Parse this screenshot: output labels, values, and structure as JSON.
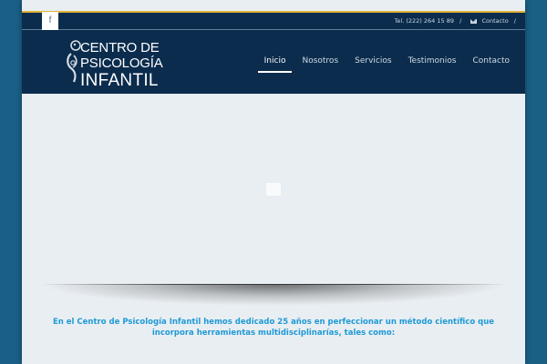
{
  "topbar": {
    "facebook_icon": "facebook-icon",
    "facebook_glyph": "f",
    "phone": "Tel. (222) 264 15 89",
    "sep1": "/",
    "contact_label": "Contacto",
    "sep2": "/",
    "mail_icon": "envelope-icon"
  },
  "logo": {
    "line1": "CENTRO DE",
    "line2": "PSICOLOGÍA",
    "line3": "INFANTIL"
  },
  "nav": {
    "items": [
      {
        "label": "Inicio",
        "active": true
      },
      {
        "label": "Nosotros",
        "active": false
      },
      {
        "label": "Servicios",
        "active": false
      },
      {
        "label": "Testimonios",
        "active": false
      },
      {
        "label": "Contacto",
        "active": false
      }
    ]
  },
  "content": {
    "intro_text": "En el Centro de Psicología Infantil hemos dedicado 25 años en perfeccionar un método científico que incorpora herramientas multidisciplinarías, tales como:"
  },
  "colors": {
    "page_bg": "#1a5f85",
    "header_bg": "#0b2c4d",
    "accent_gold": "#e0b43a",
    "intro_text": "#1f9ad6",
    "content_bg": "#e9eef2"
  }
}
